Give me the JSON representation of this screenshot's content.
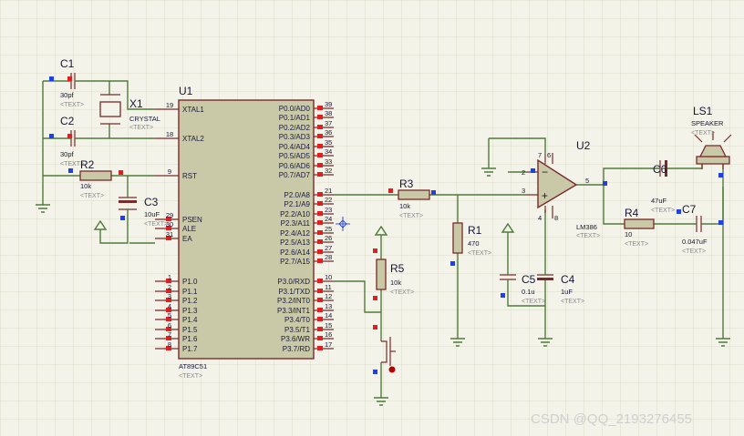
{
  "placeholder_text": "<TEXT>",
  "watermark": "CSDN @QQ_2193276455",
  "colors": {
    "background": "#f3f3ea",
    "grid": "#dcdccb",
    "wire": "#4f7a3a",
    "component": "#7a2a2a",
    "chip_fill": "#c9c9a7",
    "pin_red": "#e02020",
    "pin_blue": "#2040e0",
    "text": "#151535"
  },
  "icons": [
    "ground-icon",
    "power-arrow-icon",
    "probe-crosshair-icon",
    "push-button-icon",
    "speaker-icon"
  ],
  "mcu": {
    "ref": "U1",
    "part": "AT89C51",
    "left_pins": [
      {
        "num": "19",
        "name": "XTAL1"
      },
      {
        "num": "18",
        "name": "XTAL2"
      },
      {
        "num": "9",
        "name": "RST"
      },
      {
        "num": "29",
        "name": "PSEN"
      },
      {
        "num": "30",
        "name": "ALE"
      },
      {
        "num": "31",
        "name": "EA"
      },
      {
        "num": "1",
        "name": "P1.0"
      },
      {
        "num": "2",
        "name": "P1.1"
      },
      {
        "num": "3",
        "name": "P1.2"
      },
      {
        "num": "4",
        "name": "P1.3"
      },
      {
        "num": "5",
        "name": "P1.4"
      },
      {
        "num": "6",
        "name": "P1.5"
      },
      {
        "num": "7",
        "name": "P1.6"
      },
      {
        "num": "8",
        "name": "P1.7"
      }
    ],
    "right_pins": [
      {
        "num": "39",
        "name": "P0.0/AD0"
      },
      {
        "num": "38",
        "name": "P0.1/AD1"
      },
      {
        "num": "37",
        "name": "P0.2/AD2"
      },
      {
        "num": "36",
        "name": "P0.3/AD3"
      },
      {
        "num": "35",
        "name": "P0.4/AD4"
      },
      {
        "num": "34",
        "name": "P0.5/AD5"
      },
      {
        "num": "33",
        "name": "P0.6/AD6"
      },
      {
        "num": "32",
        "name": "P0.7/AD7"
      },
      {
        "num": "21",
        "name": "P2.0/A8"
      },
      {
        "num": "22",
        "name": "P2.1/A9"
      },
      {
        "num": "23",
        "name": "P2.2/A10"
      },
      {
        "num": "24",
        "name": "P2.3/A11"
      },
      {
        "num": "25",
        "name": "P2.4/A12"
      },
      {
        "num": "26",
        "name": "P2.5/A13"
      },
      {
        "num": "27",
        "name": "P2.6/A14"
      },
      {
        "num": "28",
        "name": "P2.7/A15"
      },
      {
        "num": "10",
        "name": "P3.0/RXD"
      },
      {
        "num": "11",
        "name": "P3.1/TXD"
      },
      {
        "num": "12",
        "name": "P3.2/INT0"
      },
      {
        "num": "13",
        "name": "P3.3/INT1"
      },
      {
        "num": "14",
        "name": "P3.4/T0"
      },
      {
        "num": "15",
        "name": "P3.5/T1"
      },
      {
        "num": "16",
        "name": "P3.6/WR"
      },
      {
        "num": "17",
        "name": "P3.7/RD"
      }
    ]
  },
  "components": {
    "c1": {
      "ref": "C1",
      "value": "30pf"
    },
    "c2": {
      "ref": "C2",
      "value": "30pf"
    },
    "x1": {
      "ref": "X1",
      "value": "CRYSTAL"
    },
    "r2": {
      "ref": "R2",
      "value": "10k"
    },
    "c3": {
      "ref": "C3",
      "value": "10uF"
    },
    "r3": {
      "ref": "R3",
      "value": "10k"
    },
    "r1": {
      "ref": "R1",
      "value": "470"
    },
    "r5": {
      "ref": "R5",
      "value": "10k"
    },
    "c5": {
      "ref": "C5",
      "value": "0.1u"
    },
    "c4": {
      "ref": "C4",
      "value": "1uF"
    },
    "u2": {
      "ref": "U2",
      "value": "LM386",
      "pins": {
        "p2": "2",
        "p3": "3",
        "p4": "4",
        "p5": "5",
        "p6": "6",
        "p7": "7",
        "p8": "8"
      }
    },
    "c6": {
      "ref": "C6",
      "value": "47uF"
    },
    "r4": {
      "ref": "R4",
      "value": "10"
    },
    "c7": {
      "ref": "C7",
      "value": "0.047uF"
    },
    "ls1": {
      "ref": "LS1",
      "value": "SPEAKER"
    }
  }
}
